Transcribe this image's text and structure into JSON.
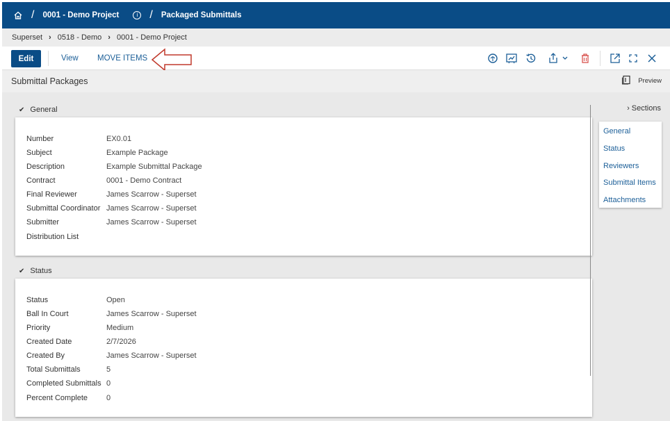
{
  "topbar": {
    "project": "0001 - Demo Project",
    "page": "Packaged Submittals"
  },
  "breadcrumb": [
    "Superset",
    "0518 - Demo",
    "0001 - Demo Project"
  ],
  "toolbar": {
    "edit_label": "Edit",
    "view_label": "View",
    "move_label": "MOVE ITEMS",
    "icons": [
      "brain-icon",
      "chart-icon",
      "history-icon",
      "share-icon",
      "delete-icon",
      "external-link-icon",
      "fullscreen-icon",
      "close-icon"
    ]
  },
  "title": "Submittal Packages",
  "preview_label": "Preview",
  "general": {
    "heading": "General",
    "rows": [
      {
        "label": "Number",
        "value": "EX0.01"
      },
      {
        "label": "Subject",
        "value": "Example Package"
      },
      {
        "label": "Description",
        "value": "Example Submittal Package"
      },
      {
        "label": "Contract",
        "value": "0001 - Demo Contract"
      },
      {
        "label": "Final Reviewer",
        "value": "James Scarrow - Superset"
      },
      {
        "label": "Submittal Coordinator",
        "value": "James Scarrow - Superset"
      },
      {
        "label": "Submitter",
        "value": "James Scarrow - Superset"
      },
      {
        "label": "Distribution List",
        "value": ""
      }
    ]
  },
  "status": {
    "heading": "Status",
    "rows": [
      {
        "label": "Status",
        "value": "Open"
      },
      {
        "label": "Ball In Court",
        "value": "James Scarrow - Superset"
      },
      {
        "label": "Priority",
        "value": "Medium"
      },
      {
        "label": "Created Date",
        "value": "2/7/2026"
      },
      {
        "label": "Created By",
        "value": "James Scarrow - Superset"
      },
      {
        "label": "Total Submittals",
        "value": "5"
      },
      {
        "label": "Completed Submittals",
        "value": "0"
      },
      {
        "label": "Percent Complete",
        "value": "0"
      }
    ]
  },
  "sections": {
    "heading": "Sections",
    "items": [
      "General",
      "Status",
      "Reviewers",
      "Submittal Items",
      "Attachments"
    ]
  },
  "colors": {
    "brand": "#0a4c86",
    "link": "#1c5f98",
    "delete": "#d9534f",
    "annotation": "#c0392b"
  }
}
